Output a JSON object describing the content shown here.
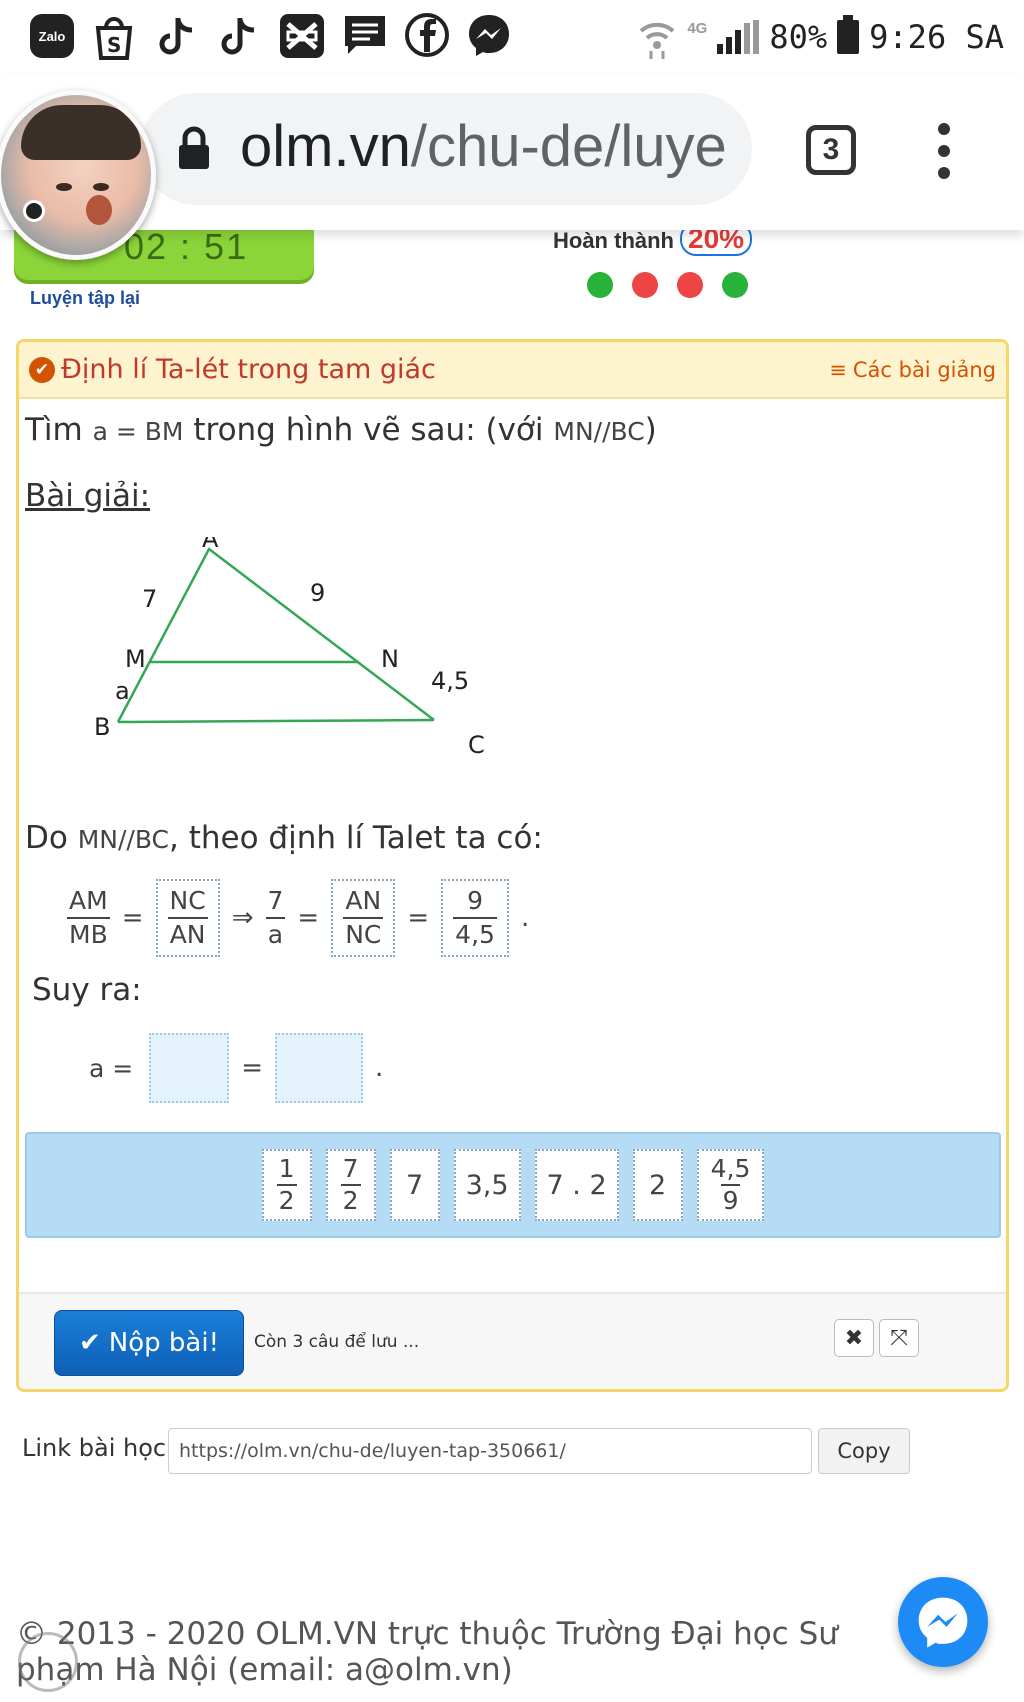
{
  "status_bar": {
    "zalo_label": "Zalo",
    "apps": [
      "zalo-icon",
      "shopee-icon",
      "tiktok-icon",
      "tiktok-icon",
      "capcut-icon",
      "messages-icon",
      "facebook-icon",
      "messenger-icon"
    ],
    "network": "4G",
    "battery": "80%",
    "time": "9:26 SA"
  },
  "browser": {
    "url_domain": "olm.vn",
    "url_path": "/chu-de/luye",
    "tab_count": "3"
  },
  "progress": {
    "timer": "02 : 51",
    "retry_label": "Luyện tập lại",
    "done_label": "Hoàn thành",
    "done_percent": "20%",
    "dot_colors": [
      "#27b33a",
      "#ef4444",
      "#ef4444",
      "#27b33a"
    ]
  },
  "question": {
    "title": "Định lí Ta-lét trong tam giác",
    "lessons_label": "Các bài giảng",
    "prompt_before": "Tìm ",
    "prompt_math1": "a = BM",
    "prompt_middle": " trong hình vẽ sau: (với ",
    "prompt_math2": "MN//BC",
    "prompt_after": ")",
    "solution_title": "Bài giải:",
    "figure": {
      "labels": {
        "A": "A",
        "B": "B",
        "C": "C",
        "M": "M",
        "N": "N"
      },
      "am": "7",
      "an": "9",
      "nc": "4,5",
      "mb": "a"
    },
    "since_before": "Do ",
    "since_math": "MN//BC",
    "since_after": ", theo định lí Talet ta có:",
    "eq": {
      "f1_num": "AM",
      "f1_den": "MB",
      "f2_num": "NC",
      "f2_den": "AN",
      "f3_num": "7",
      "f3_den": "a",
      "f4_num": "AN",
      "f4_den": "NC",
      "f5_num": "9",
      "f5_den": "4,5",
      "equals": "=",
      "implies": "⇒",
      "period": "."
    },
    "then_label": "Suy ra:",
    "answer_lhs": "a =",
    "answer_equals": "=",
    "answer_period": "."
  },
  "choices": [
    {
      "type": "frac",
      "num": "1",
      "den": "2"
    },
    {
      "type": "frac",
      "num": "7",
      "den": "2"
    },
    {
      "type": "text",
      "text": "7"
    },
    {
      "type": "text",
      "text": "3,5"
    },
    {
      "type": "text",
      "text": "7 . 2"
    },
    {
      "type": "text",
      "text": "2"
    },
    {
      "type": "frac",
      "num": "4,5",
      "den": "9"
    }
  ],
  "footer_actions": {
    "submit_label": "Nộp bài!",
    "remain_text": "Còn 3 câu để lưu ...",
    "close_symbol": "✖",
    "expand_symbol": "⤧"
  },
  "share": {
    "label": "Link bài học:",
    "url": "https://olm.vn/chu-de/luyen-tap-350661/",
    "copy_label": "Copy"
  },
  "copyright": "© 2013 - 2020 OLM.VN trực thuộc Trường Đại học Sư phạm Hà Nội (email: a@olm.vn)"
}
